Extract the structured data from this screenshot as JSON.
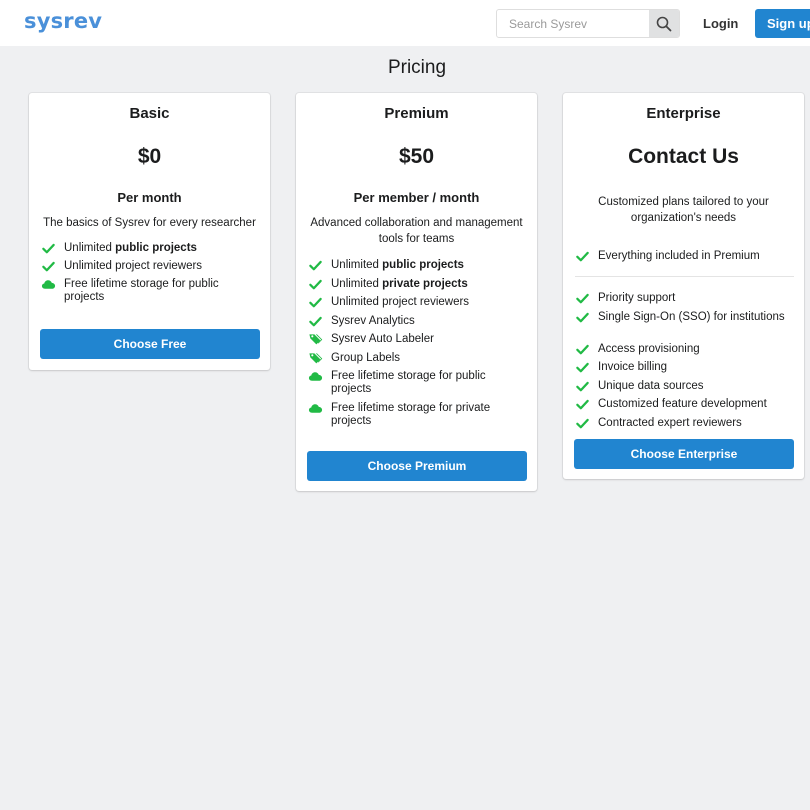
{
  "header": {
    "logo": "sysrev",
    "search_placeholder": "Search Sysrev",
    "login_label": "Login",
    "signup_label": "Sign up",
    "search_icon": "search-icon"
  },
  "page_title": "Pricing",
  "colors": {
    "brand": "#4a90d9",
    "primary_button": "#2185d0",
    "check": "#21ba45",
    "background": "#eff0f2"
  },
  "plans": {
    "basic": {
      "name": "Basic",
      "price": "$0",
      "period": "Per month",
      "description": "The basics of Sysrev for every researcher",
      "features": [
        {
          "icon": "check-icon",
          "prefix": "Unlimited ",
          "bold": "public projects"
        },
        {
          "icon": "check-icon",
          "prefix": "Unlimited project reviewers",
          "bold": ""
        },
        {
          "icon": "cloud-icon",
          "prefix": "Free lifetime storage for public projects",
          "bold": ""
        }
      ],
      "button_label": "Choose Free"
    },
    "premium": {
      "name": "Premium",
      "price": "$50",
      "period": "Per member / month",
      "description": "Advanced collaboration and management tools for teams",
      "features": [
        {
          "icon": "check-icon",
          "prefix": "Unlimited ",
          "bold": "public projects"
        },
        {
          "icon": "check-icon",
          "prefix": "Unlimited ",
          "bold": "private projects"
        },
        {
          "icon": "check-icon",
          "prefix": "Unlimited project reviewers",
          "bold": ""
        },
        {
          "icon": "check-icon",
          "prefix": "Sysrev Analytics",
          "bold": ""
        },
        {
          "icon": "tags-icon",
          "prefix": "Sysrev Auto Labeler",
          "bold": ""
        },
        {
          "icon": "tags-icon",
          "prefix": "Group Labels",
          "bold": ""
        },
        {
          "icon": "cloud-icon",
          "prefix": "Free lifetime storage for public projects",
          "bold": ""
        },
        {
          "icon": "cloud-icon",
          "prefix": "Free lifetime storage for private projects",
          "bold": ""
        }
      ],
      "button_label": "Choose Premium"
    },
    "enterprise": {
      "name": "Enterprise",
      "price": "Contact Us",
      "description": "Customized plans tailored to your organization's needs",
      "included": {
        "icon": "check-icon",
        "prefix": "Everything included in Premium",
        "bold": ""
      },
      "features": [
        {
          "icon": "check-icon",
          "prefix": "Priority support",
          "bold": ""
        },
        {
          "icon": "check-icon",
          "prefix": "Single Sign-On (SSO) for institutions",
          "bold": ""
        },
        {
          "icon": "check-icon",
          "prefix": "Access provisioning",
          "bold": ""
        },
        {
          "icon": "check-icon",
          "prefix": "Invoice billing",
          "bold": ""
        },
        {
          "icon": "check-icon",
          "prefix": "Unique data sources",
          "bold": ""
        },
        {
          "icon": "check-icon",
          "prefix": "Customized feature development",
          "bold": ""
        },
        {
          "icon": "check-icon",
          "prefix": "Contracted expert reviewers",
          "bold": ""
        }
      ],
      "button_label": "Choose Enterprise"
    }
  }
}
